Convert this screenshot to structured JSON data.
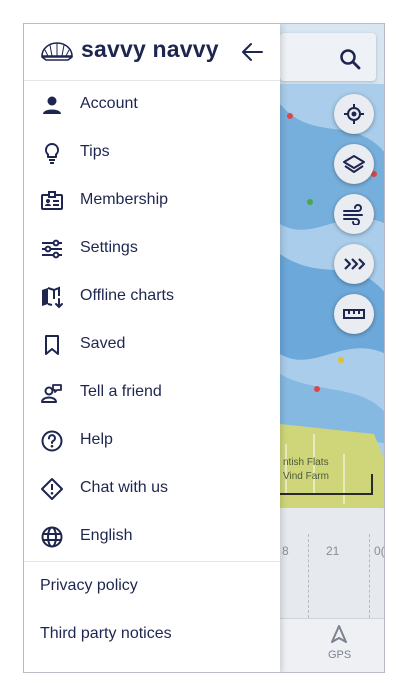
{
  "brand": {
    "name": "savvy navvy"
  },
  "menu": [
    {
      "label": "Account",
      "icon": "person-icon"
    },
    {
      "label": "Tips",
      "icon": "lightbulb-icon"
    },
    {
      "label": "Membership",
      "icon": "membership-card-icon"
    },
    {
      "label": "Settings",
      "icon": "sliders-icon"
    },
    {
      "label": "Offline charts",
      "icon": "offline-map-icon"
    },
    {
      "label": "Saved",
      "icon": "bookmark-icon"
    },
    {
      "label": "Tell a friend",
      "icon": "share-person-icon"
    },
    {
      "label": "Help",
      "icon": "question-circle-icon"
    },
    {
      "label": "Chat with us",
      "icon": "chat-diamond-icon"
    },
    {
      "label": "English",
      "icon": "globe-icon"
    }
  ],
  "footer_links": [
    "Privacy policy",
    "Third party notices"
  ],
  "map": {
    "place_label_1": "ntish Flats",
    "place_label_2": "Vind Farm",
    "ticks": [
      "8",
      "21",
      "0("
    ],
    "gps_label": "GPS"
  },
  "colors": {
    "text": "#1e2650",
    "water": "#5a9fd4",
    "land": "#cfd67a"
  }
}
